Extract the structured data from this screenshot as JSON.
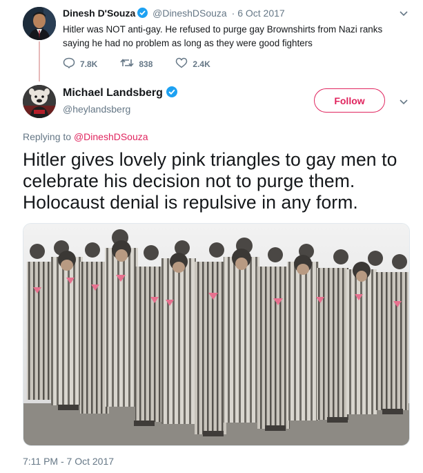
{
  "colors": {
    "accent": "#e0245e",
    "verified": "#1da1f2",
    "secondary_text": "#657786",
    "pink_triangle": "#e7718f"
  },
  "parent_tweet": {
    "author_name": "Dinesh D'Souza",
    "author_handle": "@DineshDSouza",
    "date": "6 Oct 2017",
    "text": "Hitler was NOT anti-gay. He refused to purge gay Brownshirts from Nazi ranks saying he had no problem as long as they were good fighters",
    "reply_count": "7.8K",
    "retweet_count": "838",
    "like_count": "2.4K",
    "icons": [
      "reply-icon",
      "retweet-icon",
      "like-icon",
      "chevron-down-icon",
      "verified-badge-icon"
    ]
  },
  "main_tweet": {
    "author_name": "Michael Landsberg",
    "author_handle": "@heylandsberg",
    "follow_label": "Follow",
    "replying_prefix": "Replying to",
    "replying_to": "@DineshDSouza",
    "text": "Hitler gives lovely pink triangles to gay men to celebrate his decision not to purge them. Holocaust denial is repulsive in any form.",
    "media_description": "photo",
    "timestamp": "7:11 PM - 7 Oct 2017"
  }
}
